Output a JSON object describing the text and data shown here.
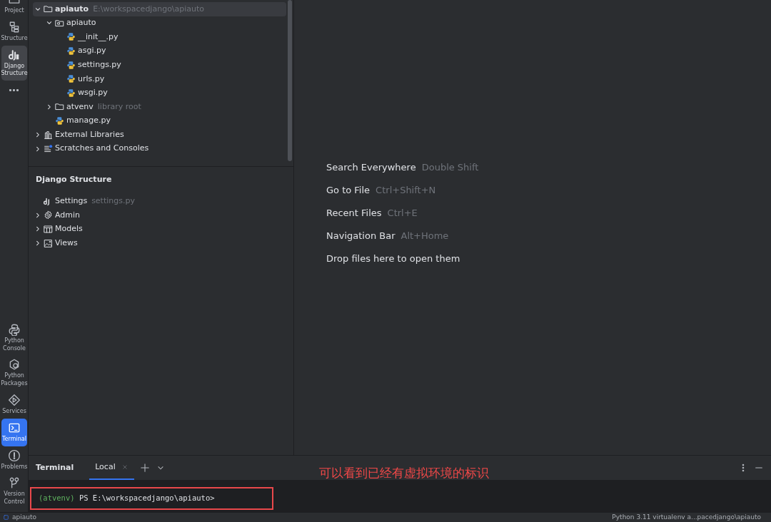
{
  "tool_strip": {
    "top_items": [
      {
        "label": "Project",
        "kind": "project",
        "selected": false
      },
      {
        "label": "Structure",
        "kind": "structure",
        "selected": false
      },
      {
        "label": "Django Structure",
        "kind": "django",
        "selected": true
      }
    ],
    "bottom_items": [
      {
        "label": "Python Console",
        "kind": "python-console",
        "selected": false
      },
      {
        "label": "Python Packages",
        "kind": "packages",
        "selected": false
      },
      {
        "label": "Services",
        "kind": "services",
        "selected": false
      },
      {
        "label": "Terminal",
        "kind": "terminal",
        "selected": true
      },
      {
        "label": "Problems",
        "kind": "problems",
        "selected": false
      },
      {
        "label": "Version Control",
        "kind": "vcs",
        "selected": false
      }
    ]
  },
  "project_tree": [
    {
      "name": "apiauto",
      "hint": "E:\\workspacedjango\\apiauto",
      "kind": "root",
      "expanded": true,
      "selected": true,
      "children": [
        {
          "name": "apiauto",
          "kind": "package",
          "expanded": true,
          "selected": false,
          "children": [
            {
              "name": "__init__.py",
              "kind": "python",
              "selected": false
            },
            {
              "name": "asgi.py",
              "kind": "python",
              "selected": false
            },
            {
              "name": "settings.py",
              "kind": "python",
              "selected": false
            },
            {
              "name": "urls.py",
              "kind": "python",
              "selected": false
            },
            {
              "name": "wsgi.py",
              "kind": "python",
              "selected": false
            }
          ]
        },
        {
          "name": "atvenv",
          "hint": "library root",
          "kind": "folder",
          "expanded": false,
          "selected": false
        },
        {
          "name": "manage.py",
          "kind": "python",
          "selected": false
        }
      ]
    },
    {
      "name": "External Libraries",
      "kind": "library",
      "expanded": false,
      "selected": false
    },
    {
      "name": "Scratches and Consoles",
      "kind": "scratches",
      "expanded": false,
      "selected": false
    }
  ],
  "django_structure": {
    "title": "Django Structure",
    "items": [
      {
        "name": "Settings",
        "hint": "settings.py",
        "kind": "django",
        "selected": false
      },
      {
        "name": "Admin",
        "kind": "gear",
        "expanded": false,
        "selected": false
      },
      {
        "name": "Models",
        "kind": "table",
        "expanded": false,
        "selected": false
      },
      {
        "name": "Views",
        "kind": "image",
        "expanded": false,
        "selected": false
      }
    ]
  },
  "editor_hints": [
    {
      "action": "Search Everywhere",
      "shortcut": "Double Shift"
    },
    {
      "action": "Go to File",
      "shortcut": "Ctrl+Shift+N"
    },
    {
      "action": "Recent Files",
      "shortcut": "Ctrl+E"
    },
    {
      "action": "Navigation Bar",
      "shortcut": "Alt+Home"
    },
    {
      "action": "Drop files here to open them"
    }
  ],
  "terminal": {
    "title": "Terminal",
    "tabs": [
      {
        "label": "Local",
        "selected": true
      }
    ],
    "venv": "(atvenv)",
    "prompt": "PS E:\\workspacedjango\\apiauto>",
    "annotation": "可以看到已经有虚拟环境的标识"
  },
  "status_bar": {
    "project": "apiauto",
    "interpreter": "Python 3.11 virtualenv a...pacedjango\\apiauto"
  }
}
